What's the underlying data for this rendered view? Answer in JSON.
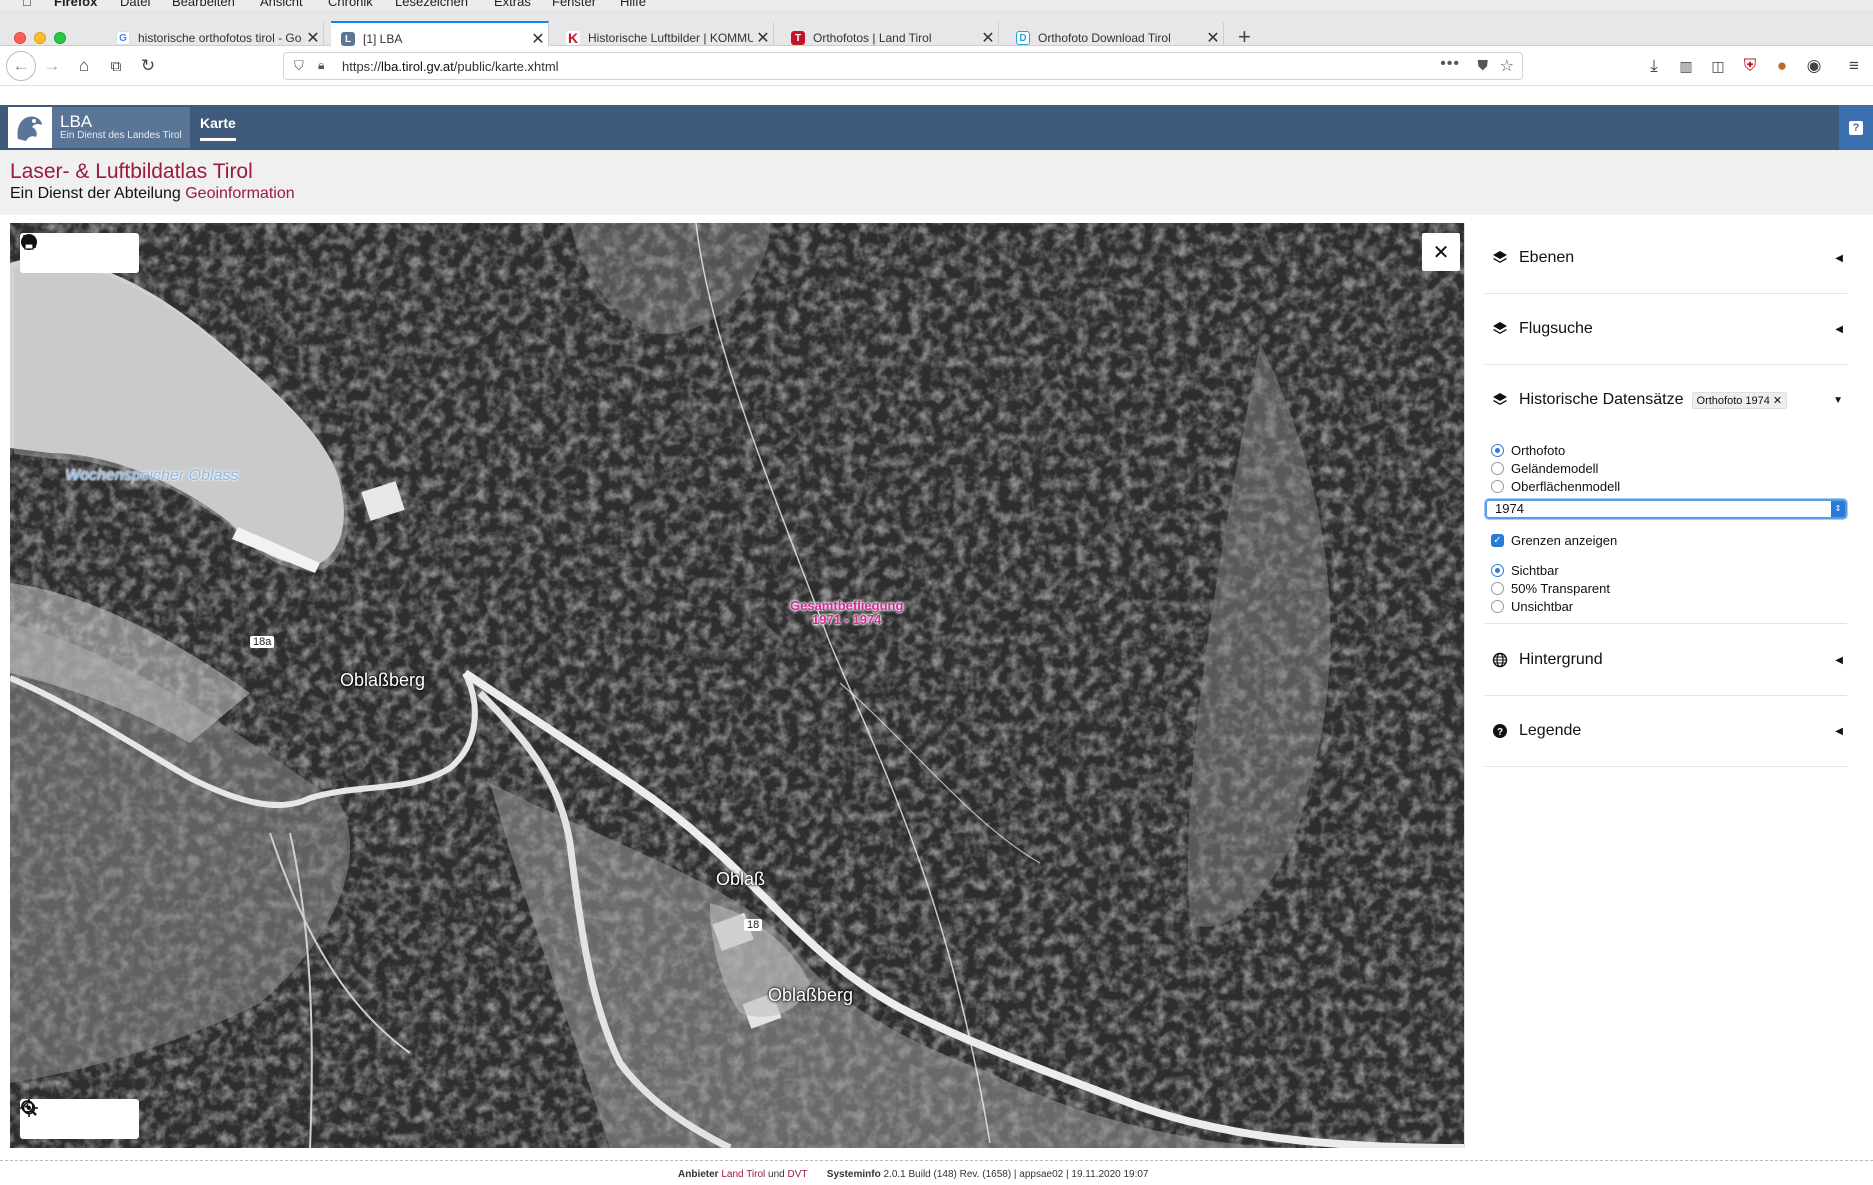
{
  "menubar": {
    "items": [
      "Firefox",
      "Datei",
      "Bearbeiten",
      "Ansicht",
      "Chronik",
      "Lesezeichen",
      "Extras",
      "Fenster",
      "Hilfe"
    ]
  },
  "tabs": [
    {
      "title": "historische orthofotos tirol - Go",
      "favicon": "google-icon",
      "active": false
    },
    {
      "title": "[1] LBA",
      "favicon": "lba-icon",
      "active": true
    },
    {
      "title": "Historische Luftbilder | KOMMU",
      "favicon": "kommunal-icon",
      "active": false
    },
    {
      "title": "Orthofotos | Land Tirol",
      "favicon": "tirol-icon",
      "active": false
    },
    {
      "title": "Orthofoto Download Tirol",
      "favicon": "download-tirol-icon",
      "active": false
    }
  ],
  "navbar": {
    "url_prefix": "https://",
    "url_host": "lba.tirol.gv.at",
    "url_path": "/public/karte.xhtml"
  },
  "app": {
    "logo_title": "LBA",
    "logo_subtitle": "Ein Dienst des Landes Tirol",
    "nav_item": "Karte",
    "help": "?"
  },
  "title_band": {
    "title": "Laser- & Luftbildatlas Tirol",
    "subtitle_prefix": "Ein Dienst der Abteilung ",
    "subtitle_link": "Geoinformation"
  },
  "map": {
    "labels": {
      "lake": "Wochenspeicher Oblass",
      "place1": "Oblaßberg",
      "place2": "Oblaß",
      "place3": "Oblaßberg",
      "road1": "18a",
      "road2": "18"
    },
    "flight_label_line1": "Gesamtbefliegung",
    "flight_label_line2": "1971 - 1974"
  },
  "panel": {
    "sections": {
      "ebenen": "Ebenen",
      "flugsuche": "Flugsuche",
      "historisch": "Historische Datensätze",
      "hintergrund": "Hintergrund",
      "legende": "Legende"
    },
    "chip": "Orthofoto 1974",
    "data_types": [
      "Orthofoto",
      "Geländemodell",
      "Oberflächenmodell"
    ],
    "selected_type": "Orthofoto",
    "year": "1974",
    "show_borders_label": "Grenzen anzeigen",
    "show_borders": true,
    "visibility": [
      "Sichtbar",
      "50% Transparent",
      "Unsichtbar"
    ],
    "selected_visibility": "Sichtbar"
  },
  "footer": {
    "provider_label": "Anbieter",
    "provider1": "Land Tirol",
    "and": "und",
    "provider2": "DVT",
    "sysinfo_label": "Systeminfo",
    "sysinfo": "2.0.1 Build (148) Rev. (1658) | appsae02 | 19.11.2020 19:07"
  }
}
